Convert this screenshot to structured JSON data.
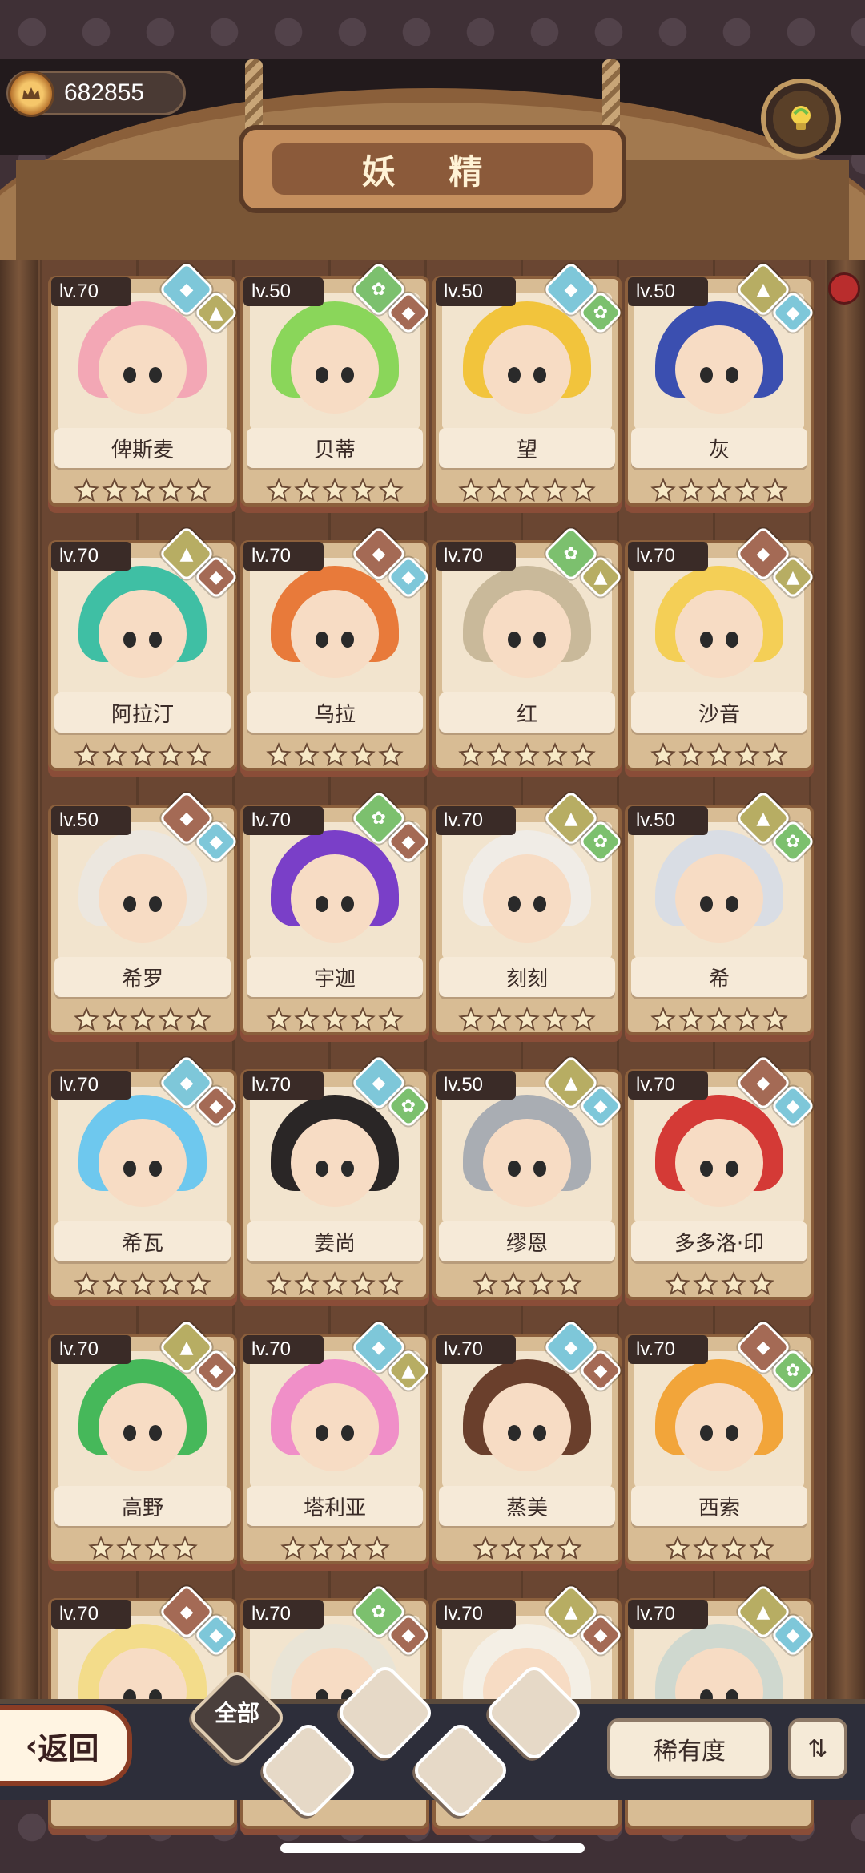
{
  "currency": {
    "value": "682855",
    "icon": "crown-coin-icon"
  },
  "title": "妖 精",
  "help_icon": "lightbulb-icon",
  "colors": {
    "water": "#7ec7d9",
    "earth": "#b7ad63",
    "fire": "#a46a55",
    "plant": "#7cc06e"
  },
  "cards": [
    {
      "lv": "lv.70",
      "name": "俾斯麦",
      "stars": 5,
      "e1": "water",
      "e2": "earth",
      "hair": "#f3a7b5"
    },
    {
      "lv": "lv.50",
      "name": "贝蒂",
      "stars": 5,
      "e1": "plant",
      "e2": "fire",
      "hair": "#8ad65a"
    },
    {
      "lv": "lv.50",
      "name": "望",
      "stars": 5,
      "e1": "water",
      "e2": "plant",
      "hair": "#f2c43c"
    },
    {
      "lv": "lv.50",
      "name": "灰",
      "stars": 5,
      "e1": "earth",
      "e2": "water",
      "hair": "#3b4fb0"
    },
    {
      "lv": "lv.70",
      "name": "阿拉汀",
      "stars": 5,
      "e1": "earth",
      "e2": "fire",
      "hair": "#3fbfa4"
    },
    {
      "lv": "lv.70",
      "name": "乌拉",
      "stars": 5,
      "e1": "fire",
      "e2": "water",
      "hair": "#e87a3a"
    },
    {
      "lv": "lv.70",
      "name": "红",
      "stars": 5,
      "e1": "plant",
      "e2": "earth",
      "hair": "#c9b99a"
    },
    {
      "lv": "lv.70",
      "name": "沙音",
      "stars": 5,
      "e1": "fire",
      "e2": "earth",
      "hair": "#f4cf56"
    },
    {
      "lv": "lv.50",
      "name": "希罗",
      "stars": 5,
      "e1": "fire",
      "e2": "water",
      "hair": "#ece7df"
    },
    {
      "lv": "lv.70",
      "name": "宇迦",
      "stars": 5,
      "e1": "plant",
      "e2": "fire",
      "hair": "#7a3fc8"
    },
    {
      "lv": "lv.70",
      "name": "刻刻",
      "stars": 5,
      "e1": "earth",
      "e2": "plant",
      "hair": "#f0ece6"
    },
    {
      "lv": "lv.50",
      "name": "希",
      "stars": 5,
      "e1": "earth",
      "e2": "plant",
      "hair": "#d9dde4"
    },
    {
      "lv": "lv.70",
      "name": "希瓦",
      "stars": 5,
      "e1": "water",
      "e2": "fire",
      "hair": "#6ec8ee"
    },
    {
      "lv": "lv.70",
      "name": "姜尚",
      "stars": 5,
      "e1": "water",
      "e2": "plant",
      "hair": "#2a2626"
    },
    {
      "lv": "lv.50",
      "name": "缪恩",
      "stars": 4,
      "e1": "earth",
      "e2": "water",
      "hair": "#a9adb3"
    },
    {
      "lv": "lv.70",
      "name": "多多洛·印",
      "stars": 4,
      "e1": "fire",
      "e2": "water",
      "hair": "#d43a36"
    },
    {
      "lv": "lv.70",
      "name": "高野",
      "stars": 4,
      "e1": "earth",
      "e2": "fire",
      "hair": "#46b85a"
    },
    {
      "lv": "lv.70",
      "name": "塔利亚",
      "stars": 4,
      "e1": "water",
      "e2": "earth",
      "hair": "#f08fc8"
    },
    {
      "lv": "lv.70",
      "name": "蒸美",
      "stars": 4,
      "e1": "water",
      "e2": "fire",
      "hair": "#6a3f2c"
    },
    {
      "lv": "lv.70",
      "name": "西索",
      "stars": 4,
      "e1": "fire",
      "e2": "plant",
      "hair": "#f2a53a"
    },
    {
      "lv": "lv.70",
      "name": "",
      "stars": 0,
      "e1": "fire",
      "e2": "water",
      "hair": "#f3dc8a"
    },
    {
      "lv": "lv.70",
      "name": "",
      "stars": 0,
      "e1": "plant",
      "e2": "fire",
      "hair": "#e9e4d6"
    },
    {
      "lv": "lv.70",
      "name": "",
      "stars": 0,
      "e1": "earth",
      "e2": "fire",
      "hair": "#f4efe5"
    },
    {
      "lv": "lv.70",
      "name": "",
      "stars": 0,
      "e1": "earth",
      "e2": "water",
      "hair": "#cfd8cf"
    }
  ],
  "bottom": {
    "back_label": "返回",
    "all_tab": "全部",
    "filter_tabs": [
      "plant-icon",
      "water-icon",
      "earth-icon",
      "fire-icon"
    ],
    "sort_label": "稀有度",
    "order_icon": "sort-order-icon"
  }
}
